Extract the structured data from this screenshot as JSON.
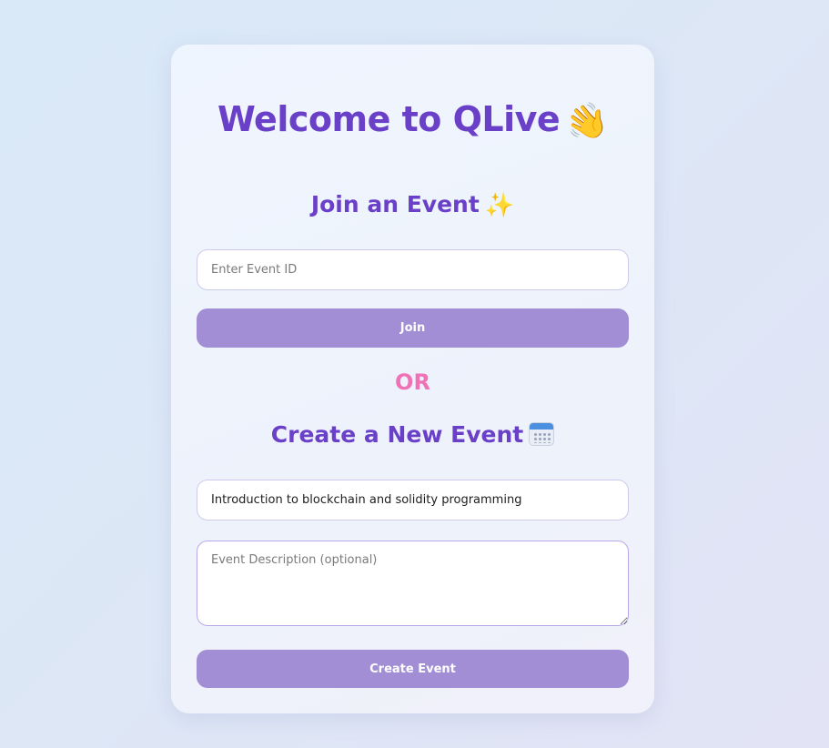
{
  "header": {
    "title": "Welcome to QLive",
    "title_emoji": "👋"
  },
  "join_section": {
    "title": "Join an Event",
    "title_emoji": "✨",
    "event_id_placeholder": "Enter Event ID",
    "event_id_value": "",
    "join_label": "Join"
  },
  "divider": {
    "label": "OR"
  },
  "create_section": {
    "title": "Create a New Event",
    "title_icon": "calendar-icon",
    "event_name_value": "Introduction to blockchain and solidity programming",
    "description_placeholder": "Event Description (optional)",
    "description_value": "",
    "create_label": "Create Event"
  },
  "colors": {
    "title": "#6a40c8",
    "or_text": "#ee72b5",
    "button": "#a18ed4",
    "button_text": "#ffffff"
  }
}
